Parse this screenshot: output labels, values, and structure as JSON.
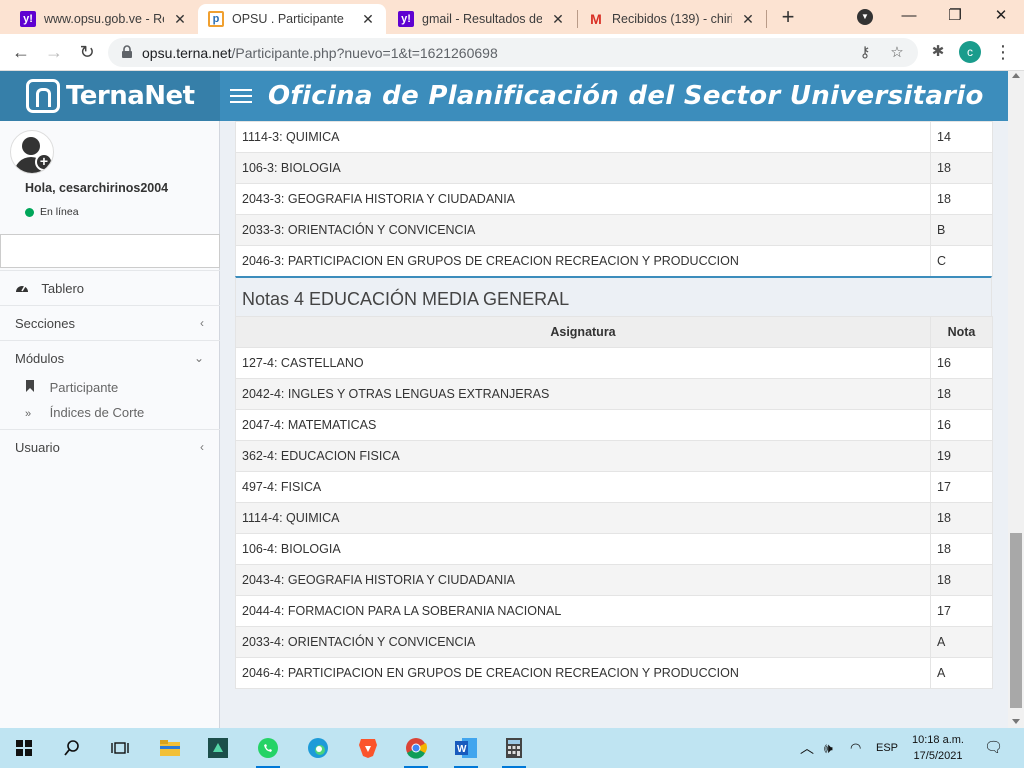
{
  "browser": {
    "tabs": [
      {
        "title": "www.opsu.gob.ve - Res",
        "favicon": "yahoo-icon",
        "active": false
      },
      {
        "title": "OPSU . Participante",
        "favicon": "ternanet-icon",
        "active": true
      },
      {
        "title": "gmail - Resultados de la",
        "favicon": "yahoo-icon",
        "active": false
      },
      {
        "title": "Recibidos (139) - chirin",
        "favicon": "gmail-icon",
        "active": false
      }
    ],
    "url_host": "opsu.terna.net",
    "url_path": "/Participante.php?nuevo=1&t=1621260698",
    "profile_initial": "c"
  },
  "header": {
    "logo_text": "TernaNet",
    "title": "Oficina de Planificación del Sector Universitario",
    "brand_color": "#3c8dbc"
  },
  "sidebar": {
    "greeting": "Hola, cesarchirinos2004",
    "status": "En línea",
    "menu": [
      {
        "label": "Tablero",
        "icon": "dashboard-icon"
      },
      {
        "label": "Secciones",
        "icon": "chevron-left-icon"
      },
      {
        "label": "Módulos",
        "icon": "chevron-down-icon"
      },
      {
        "label": "Usuario",
        "icon": "chevron-left-icon"
      }
    ],
    "submenu": [
      {
        "label": "Participante",
        "icon": "bookmark-icon"
      },
      {
        "label": "Índices de Corte",
        "icon": "double-chevron-right-icon"
      }
    ]
  },
  "grades3": {
    "rows": [
      {
        "subject": "1114-3: QUIMICA",
        "grade": "14"
      },
      {
        "subject": "106-3: BIOLOGIA",
        "grade": "18"
      },
      {
        "subject": "2043-3: GEOGRAFIA HISTORIA Y CIUDADANIA",
        "grade": "18"
      },
      {
        "subject": "2033-3: ORIENTACIÓN Y CONVICENCIA",
        "grade": "B"
      },
      {
        "subject": "2046-3: PARTICIPACION EN GRUPOS DE CREACION RECREACION Y PRODUCCION",
        "grade": "C"
      }
    ]
  },
  "grades4": {
    "title": "Notas 4 EDUCACIÓN MEDIA GENERAL",
    "col_subject": "Asignatura",
    "col_grade": "Nota",
    "rows": [
      {
        "subject": "127-4: CASTELLANO",
        "grade": "16"
      },
      {
        "subject": "2042-4: INGLES Y OTRAS LENGUAS EXTRANJERAS",
        "grade": "18"
      },
      {
        "subject": "2047-4: MATEMATICAS",
        "grade": "16"
      },
      {
        "subject": "362-4: EDUCACION FISICA",
        "grade": "19"
      },
      {
        "subject": "497-4: FISICA",
        "grade": "17"
      },
      {
        "subject": "1114-4: QUIMICA",
        "grade": "18"
      },
      {
        "subject": "106-4: BIOLOGIA",
        "grade": "18"
      },
      {
        "subject": "2043-4: GEOGRAFIA HISTORIA Y CIUDADANIA",
        "grade": "18"
      },
      {
        "subject": "2044-4: FORMACION PARA LA SOBERANIA NACIONAL",
        "grade": "17"
      },
      {
        "subject": "2033-4: ORIENTACIÓN Y CONVICENCIA",
        "grade": "A"
      },
      {
        "subject": "2046-4: PARTICIPACION EN GRUPOS DE CREACION RECREACION Y PRODUCCION",
        "grade": "A"
      }
    ]
  },
  "taskbar": {
    "language": "ESP",
    "time": "10:18 a.m.",
    "date": "17/5/2021"
  }
}
